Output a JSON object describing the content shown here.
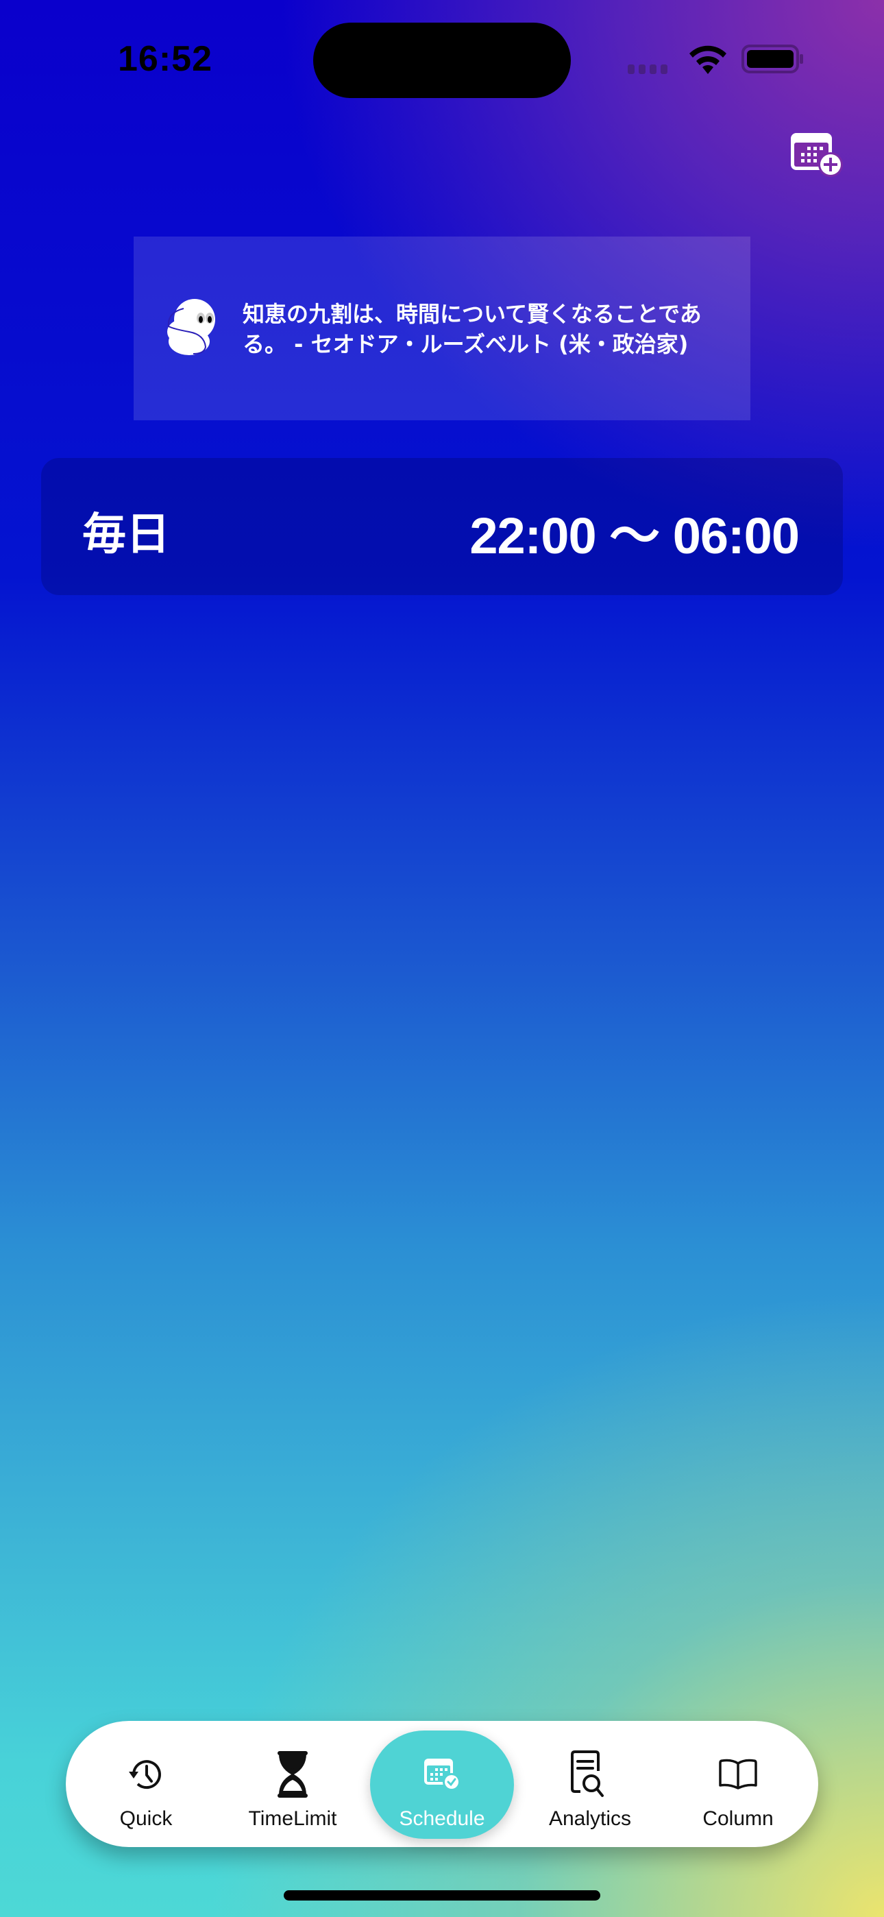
{
  "status_bar": {
    "time": "16:52",
    "icons": [
      "cellular-signal-icon",
      "wifi-icon",
      "battery-icon"
    ]
  },
  "header": {
    "add_schedule_icon": "calendar-plus-icon"
  },
  "quote": {
    "mascot_icon": "ghost-mascot-icon",
    "text": "知恵の九割は、時間について賢くなることである。 - セオドア・ルーズベルト (米・政治家)"
  },
  "schedules": [
    {
      "day": "毎日",
      "time_range": "22:00 〜 06:00"
    }
  ],
  "tabbar": {
    "active": "Schedule",
    "tabs": [
      {
        "label": "Quick",
        "icon": "history-clock-icon"
      },
      {
        "label": "TimeLimit",
        "icon": "hourglass-icon"
      },
      {
        "label": "Schedule",
        "icon": "calendar-check-icon"
      },
      {
        "label": "Analytics",
        "icon": "document-search-icon"
      },
      {
        "label": "Column",
        "icon": "book-icon"
      }
    ]
  },
  "colors": {
    "accent": "#4fd3d4",
    "gradient_top": "#0a00cc",
    "gradient_top_right": "#8c30aa",
    "gradient_bottom_left": "#48d2d8",
    "gradient_bottom_right": "#ebe46e"
  }
}
